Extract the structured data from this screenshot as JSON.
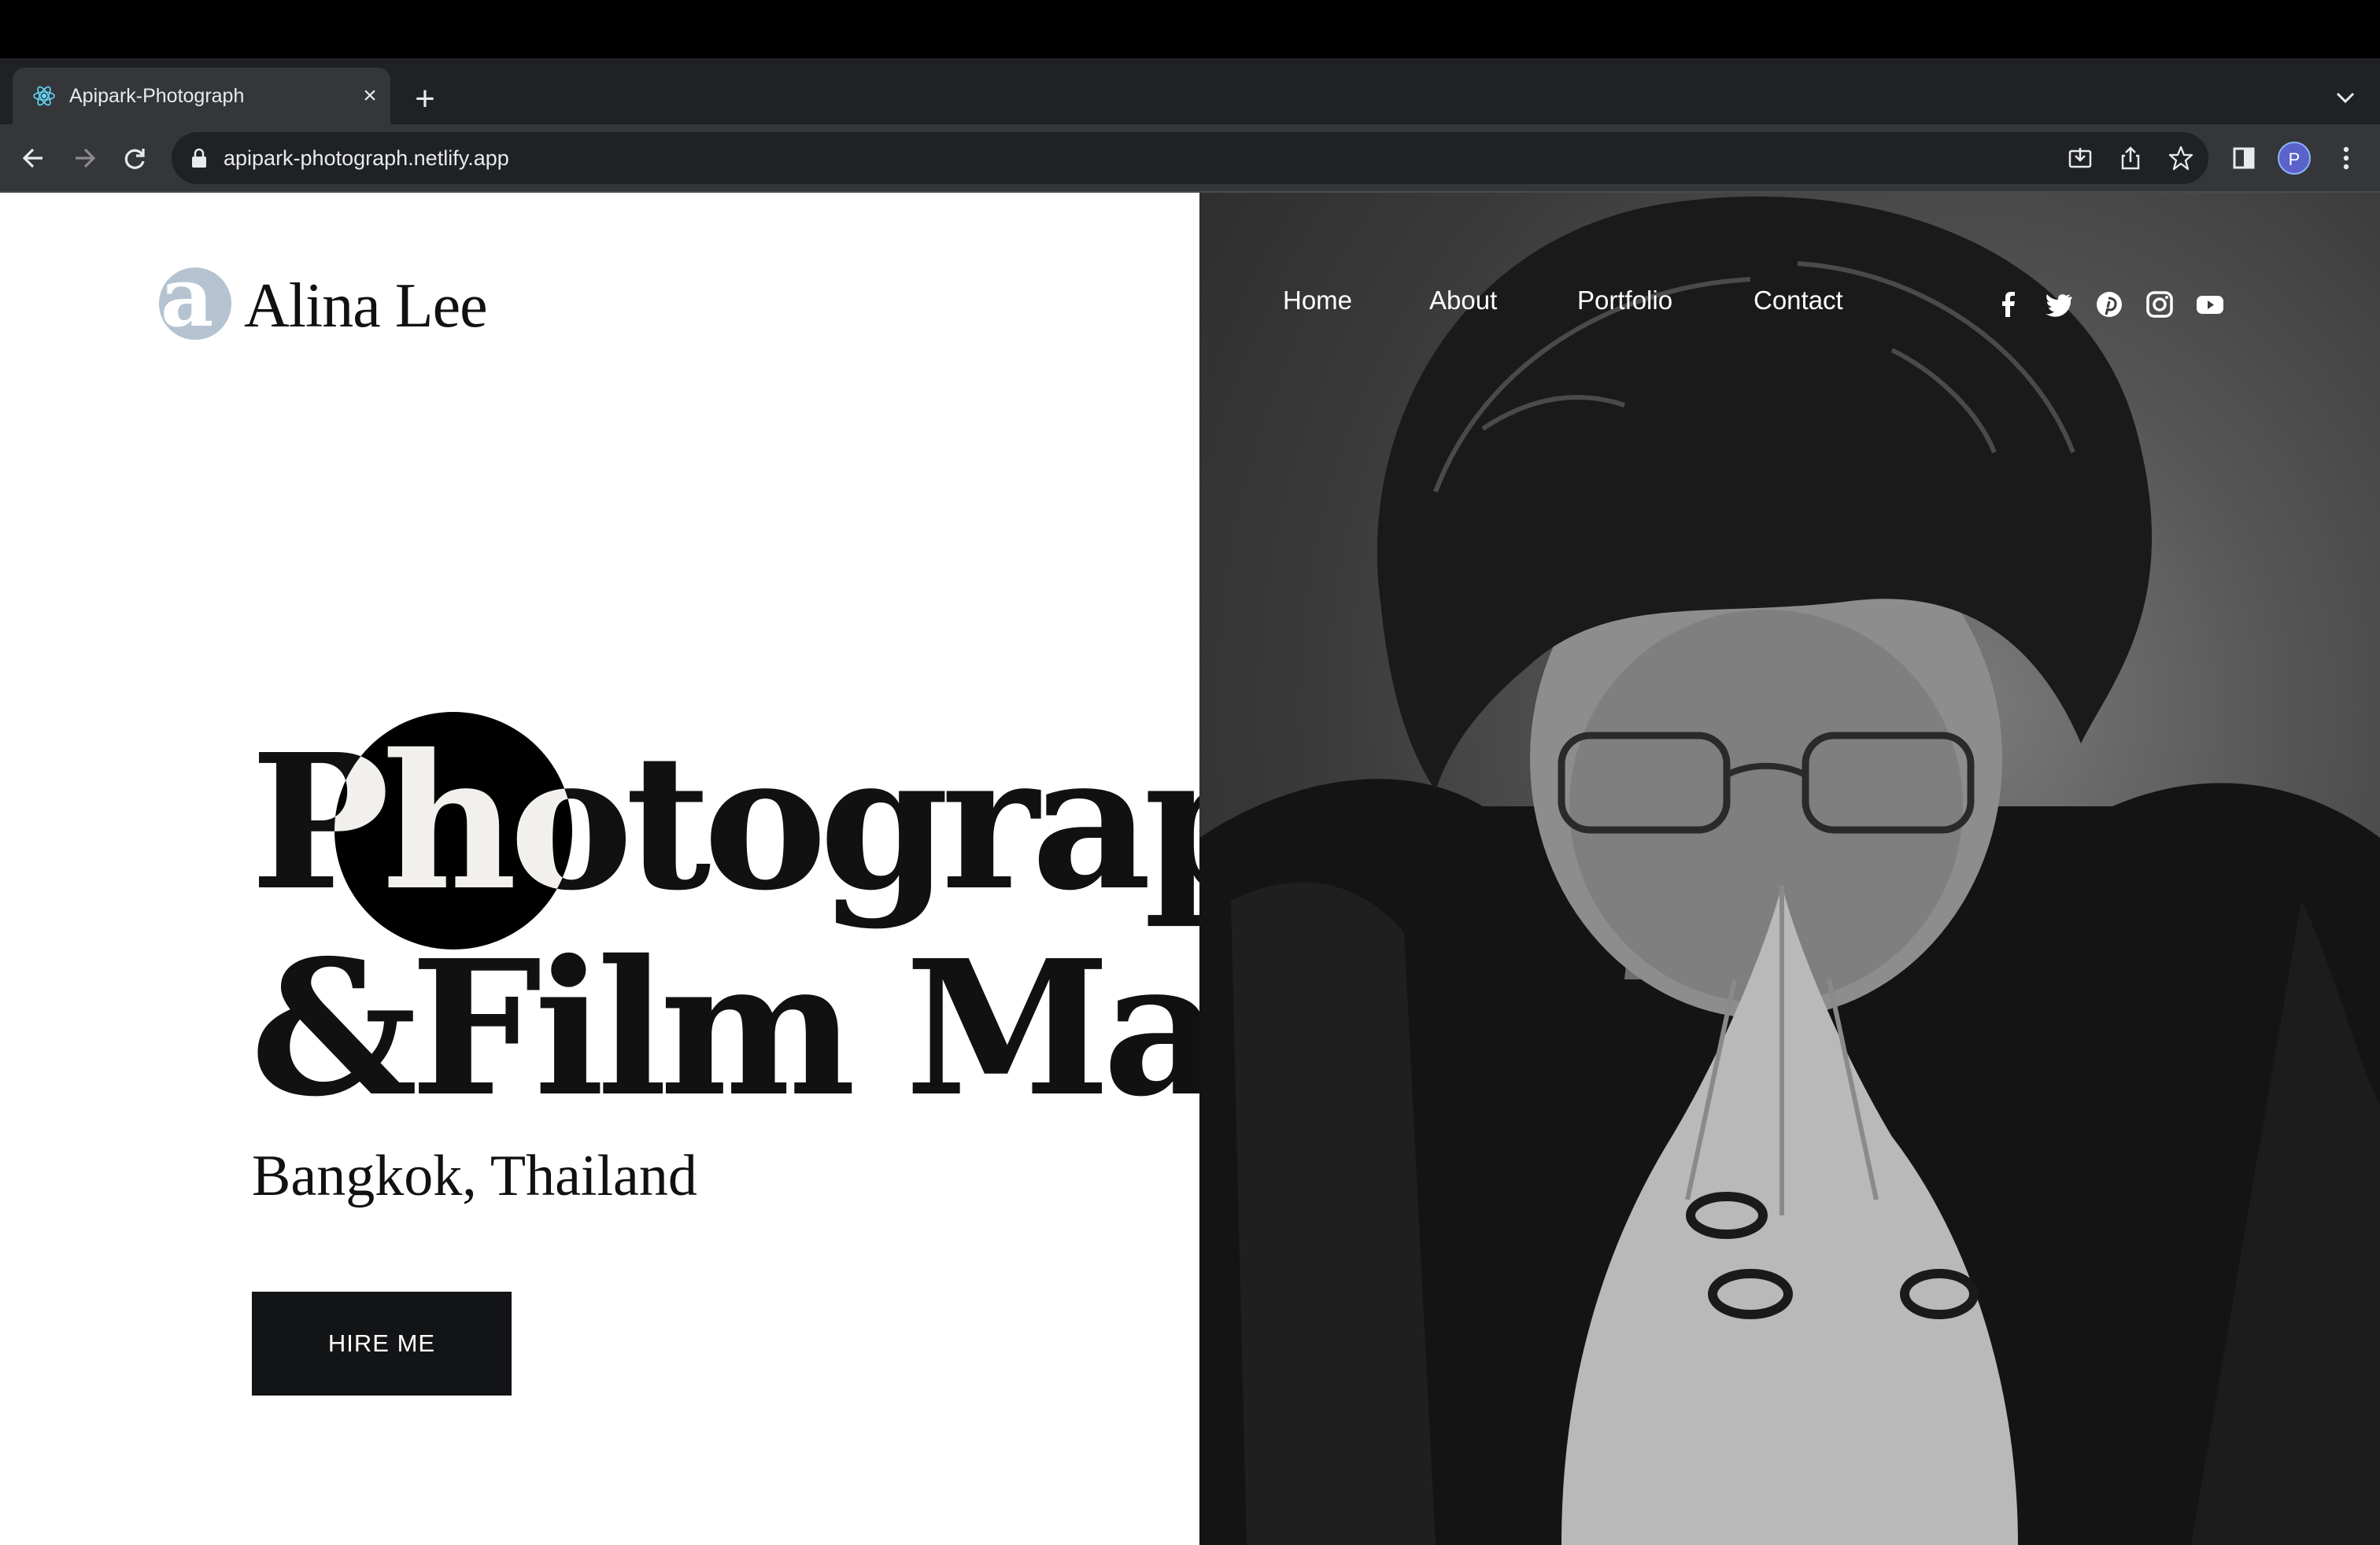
{
  "browser": {
    "tab_title": "Apipark-Photograph",
    "url": "apipark-photograph.netlify.app",
    "profile_initial": "P"
  },
  "site": {
    "logo_mark": "a",
    "logo_name": "Alina Lee",
    "nav": [
      "Home",
      "About",
      "Portfolio",
      "Contact"
    ],
    "social_icons": [
      "facebook-icon",
      "twitter-icon",
      "pinterest-icon",
      "instagram-icon",
      "youtube-icon"
    ],
    "hero_line1": "Photographer",
    "hero_line2": "&Film Maker",
    "location": "Bangkok, Thailand",
    "cta_label": "HIRE ME"
  },
  "colors": {
    "accent_dark": "#131416",
    "logo_mark_bg": "#b5c3d1",
    "chrome_bg": "#35363a"
  }
}
